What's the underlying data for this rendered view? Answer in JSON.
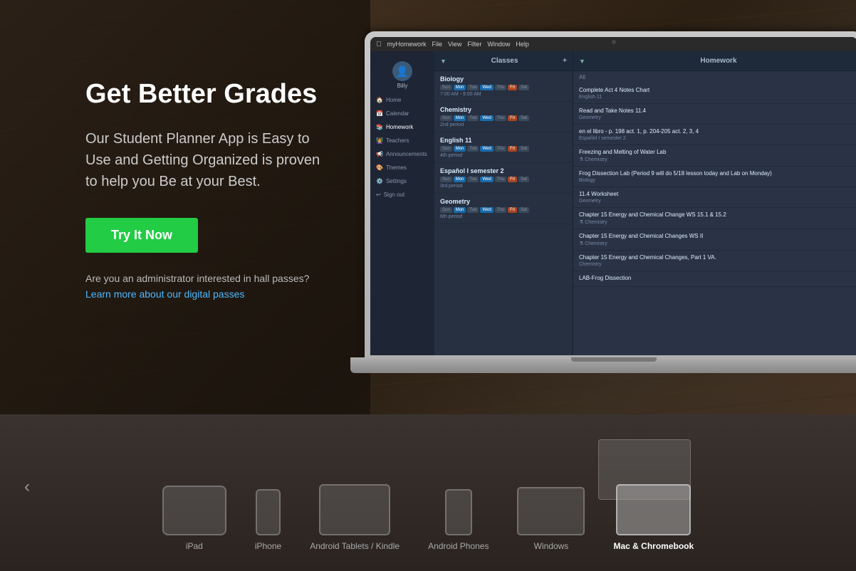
{
  "page": {
    "title": "myHomework Student Planner"
  },
  "hero": {
    "headline": "Get Better Grades",
    "subheadline": "Our Student Planner App is Easy to Use and Getting Organized is proven to help you Be at your Best.",
    "cta_label": "Try It Now",
    "admin_text": "Are you an administrator interested in hall passes?",
    "learn_more_label": "Learn more about our digital passes",
    "cta_color": "#22cc44"
  },
  "app": {
    "menu_items": [
      "myHomework",
      "File",
      "View",
      "Filter",
      "Window",
      "Help"
    ],
    "sidebar_items": [
      {
        "label": "Billy",
        "icon": "👤"
      },
      {
        "label": "Home",
        "icon": "🏠"
      },
      {
        "label": "Calendar",
        "icon": "📅"
      },
      {
        "label": "Homework",
        "icon": "📚"
      },
      {
        "label": "Teachers",
        "icon": "👩‍🏫"
      },
      {
        "label": "Announcements",
        "icon": "📢"
      },
      {
        "label": "Themes",
        "icon": "🎨"
      },
      {
        "label": "Settings",
        "icon": "⚙️"
      },
      {
        "label": "Sign out",
        "icon": "↩️"
      }
    ],
    "classes": [
      {
        "name": "Biology",
        "time": "7:00 AM - 9:00 AM",
        "period": ""
      },
      {
        "name": "Chemistry",
        "period": "2nd period"
      },
      {
        "name": "English 11",
        "period": "4th period"
      },
      {
        "name": "Español I semester 2",
        "period": "3rd period"
      },
      {
        "name": "Geometry",
        "period": "6th period"
      }
    ],
    "homework_items": [
      {
        "title": "Complete Act 4 Notes Chart",
        "subject": "English 11"
      },
      {
        "title": "Read and Take Notes 11.4",
        "subject": "Geometry"
      },
      {
        "title": "en el libro - p. 198 act. 1, p. 204-205 act. 2, 3, 4",
        "subject": "Español I semester 2"
      },
      {
        "title": "Freezing and Melting of Water Lab",
        "subject": "Chemistry"
      },
      {
        "title": "Frog Dissection Lab (Period 9 will do 5/18 lesson today and Lab on Monday)",
        "subject": "Biology"
      },
      {
        "title": "11.4 Worksheet",
        "subject": "Geometry"
      },
      {
        "title": "Chapter 15 Energy and Chemical Change WS 15.1 & 15.2",
        "subject": "Chemistry"
      },
      {
        "title": "Chapter 15 Energy and Chemical Changes WS II",
        "subject": "Chemistry"
      },
      {
        "title": "Chapter 15 Energy and Chemical Changes, Part 1 VA.",
        "subject": "Chemistry"
      },
      {
        "title": "LAB-Frog Dissection",
        "subject": ""
      }
    ]
  },
  "devices": [
    {
      "label": "iPad",
      "type": "ipad"
    },
    {
      "label": "iPhone",
      "type": "iphone"
    },
    {
      "label": "Android Tablets / Kindle",
      "type": "tablet"
    },
    {
      "label": "Android Phones",
      "type": "android-phone"
    },
    {
      "label": "Windows",
      "type": "windows"
    },
    {
      "label": "Mac & Chromebook",
      "type": "mac"
    }
  ],
  "nav": {
    "arrow_label": "‹"
  }
}
